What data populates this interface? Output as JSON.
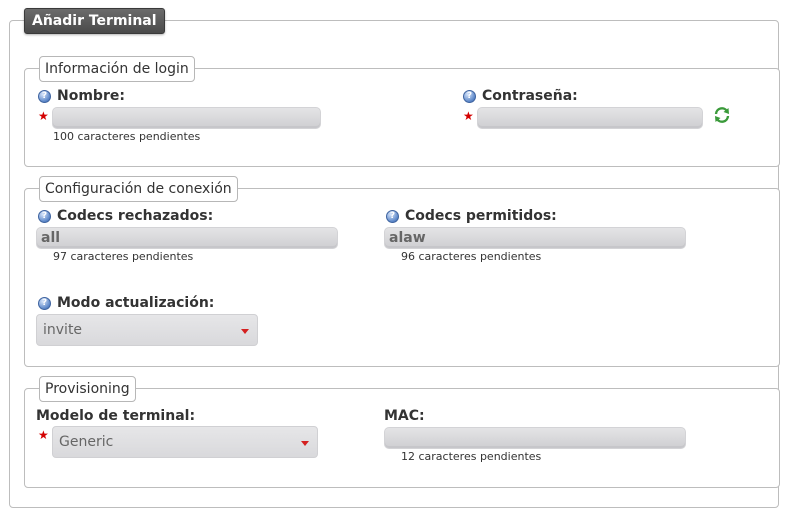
{
  "title": "Añadir Terminal",
  "login": {
    "legend": "Información de login",
    "nombre": {
      "label": "Nombre:",
      "value": "",
      "hint": "100 caracteres pendientes"
    },
    "contrasena": {
      "label": "Contraseña:",
      "value": ""
    }
  },
  "conexion": {
    "legend": "Configuración de conexión",
    "codecs_rechazados": {
      "label": "Codecs rechazados:",
      "value": "all",
      "hint": "97 caracteres pendientes"
    },
    "codecs_permitidos": {
      "label": "Codecs permitidos:",
      "value": "alaw",
      "hint": "96 caracteres pendientes"
    },
    "modo_actualizacion": {
      "label": "Modo actualización:",
      "selected": "invite"
    }
  },
  "provisioning": {
    "legend": "Provisioning",
    "modelo": {
      "label": "Modelo de terminal:",
      "selected": "Generic"
    },
    "mac": {
      "label": "MAC:",
      "value": "",
      "hint": "12 caracteres pendientes"
    }
  },
  "colors": {
    "title_bg": "#555555",
    "required_star": "#d40000",
    "help_icon": "#5b86c8",
    "refresh_icon": "#3a9a3a"
  },
  "icons": {
    "help": "question-circle-icon",
    "required": "star-icon",
    "refresh": "refresh-icon",
    "dropdown": "chevron-down-icon"
  }
}
